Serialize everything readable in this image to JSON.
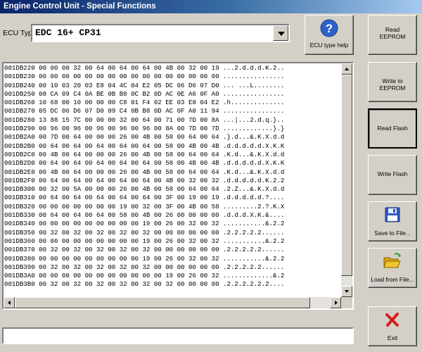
{
  "window": {
    "title": "Engine Control Unit - Special Functions"
  },
  "ecu": {
    "label": "ECU Type:",
    "selected": "EDC 16+ CP31"
  },
  "buttons": {
    "help": "ECU type help",
    "read_eeprom": "Read EEPROM",
    "write_eeprom": "Write to EEPROM",
    "read_flash": "Read Flash",
    "write_flash": "Write Flash",
    "save": "Save to File...",
    "load": "Load from File...",
    "exit": "Exit"
  },
  "icons": {
    "help": "help-question-icon",
    "save": "floppy-disk-icon",
    "load": "open-folder-icon",
    "exit": "red-x-icon"
  },
  "colors": {
    "title_start": "#0a246a",
    "help_icon": "#2e62c9",
    "exit_icon": "#d42020",
    "folder": "#f4c430",
    "floppy": "#2b55c8"
  },
  "hex_dump": {
    "lines": [
      "001DB220 00 00 00 32 00 64 00 64 00 64 00 4B 00 32 00 19 ...2.d.d.d.K.2..",
      "001DB230 00 00 00 00 00 00 00 00 00 00 00 00 00 00 00 00 ................",
      "001DB240 00 10 03 20 03 E8 04 4C 04 E2 05 DC 06 D6 07 D0 ... ...L........",
      "001DB250 08 CA 09 C4 0A BE 0B B8 0C B2 0D AC 0E A6 0F A0 ................",
      "001DB260 10 68 00 10 00 00 00 C8 01 F4 02 EE 03 E8 04 E2 .h..............",
      "001DB270 05 DC 06 D6 07 D0 09 C4 0B B8 0D AC 0F A0 11 94 ................",
      "001DB280 13 88 15 7C 00 00 00 32 00 64 00 71 00 7D 00 8A ...|...2.d.q.}..",
      "001DB290 00 96 00 96 00 96 00 96 00 96 00 8A 00 7D 00 7D .............}.}",
      "001DB2A0 00 7D 00 64 00 00 00 26 00 4B 00 58 00 64 00 64 .}.d...&.K.X.d.d",
      "001DB2B0 00 64 00 64 00 64 00 64 00 64 00 58 00 4B 00 4B .d.d.d.d.d.X.K.K",
      "001DB2C0 00 4B 00 64 00 00 00 26 00 4B 00 58 00 64 00 64 .K.d...&.K.X.d.d",
      "001DB2D0 00 64 00 64 00 64 00 64 00 64 00 58 00 4B 00 4B .d.d.d.d.d.X.K.K",
      "001DB2E0 00 4B 00 64 00 00 00 26 00 4B 00 58 00 64 00 64 .K.d...&.K.X.d.d",
      "001DB2F0 00 64 00 64 00 64 00 64 00 64 00 4B 00 32 00 32 .d.d.d.d.d.K.2.2",
      "001DB300 00 32 00 5A 00 00 00 26 00 4B 00 58 00 64 00 64 .2.Z...&.K.X.d.d",
      "001DB310 00 64 00 64 00 64 00 64 00 64 00 3F 00 19 00 19 .d.d.d.d.d.?....",
      "001DB320 00 00 00 00 00 00 00 19 00 32 00 3F 00 4B 00 58 .........2.?.K.X",
      "001DB330 00 64 00 64 00 64 00 58 00 4B 00 26 00 00 00 00 .d.d.d.X.K.&....",
      "001DB340 00 00 00 00 00 00 00 00 00 19 00 26 00 32 00 32 ...........&.2.2",
      "001DB350 00 32 00 32 00 32 00 32 00 32 00 00 00 00 00 00 .2.2.2.2.2......",
      "001DB360 00 00 00 00 00 00 00 00 00 19 00 26 00 32 00 32 ...........&.2.2",
      "001DB370 00 32 00 32 00 32 00 32 00 32 00 00 00 00 00 00 .2.2.2.2.2......",
      "001DB380 00 00 00 00 00 00 00 00 00 19 00 26 00 32 00 32 ...........&.2.2",
      "001DB390 00 32 00 32 00 32 00 32 00 32 00 00 00 00 00 00 .2.2.2.2.2......",
      "001DB3A0 00 00 00 00 00 00 00 00 00 00 00 19 00 26 00 32 .............&.2",
      "001DB3B0 00 32 00 32 00 32 00 32 00 32 00 32 00 00 00 00 .2.2.2.2.2.2...."
    ]
  },
  "status": {
    "text": ""
  }
}
